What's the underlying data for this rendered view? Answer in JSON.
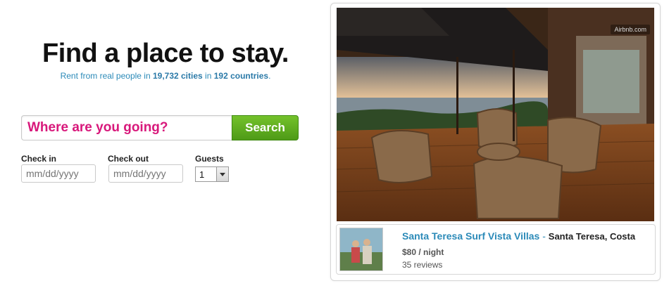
{
  "hero": {
    "headline": "Find a place to stay.",
    "sub_prefix": "Rent from real people in ",
    "cities": "19,732 cities",
    "sub_middle": " in ",
    "countries": "192 countries",
    "sub_suffix": "."
  },
  "search": {
    "placeholder": "Where are you going?",
    "button_label": "Search"
  },
  "fields": {
    "checkin_label": "Check in",
    "checkin_placeholder": "mm/dd/yyyy",
    "checkout_label": "Check out",
    "checkout_placeholder": "mm/dd/yyyy",
    "guests_label": "Guests",
    "guests_value": "1"
  },
  "featured": {
    "watermark": "Airbnb.com",
    "name": "Santa Teresa Surf Vista Villas",
    "separator": " - ",
    "location": "Santa Teresa, Costa",
    "price": "$80 / night",
    "reviews": "35 reviews"
  },
  "colors": {
    "link_blue": "#2b8ab8",
    "search_pink": "#d8187b",
    "button_green": "#5aaa1c"
  }
}
